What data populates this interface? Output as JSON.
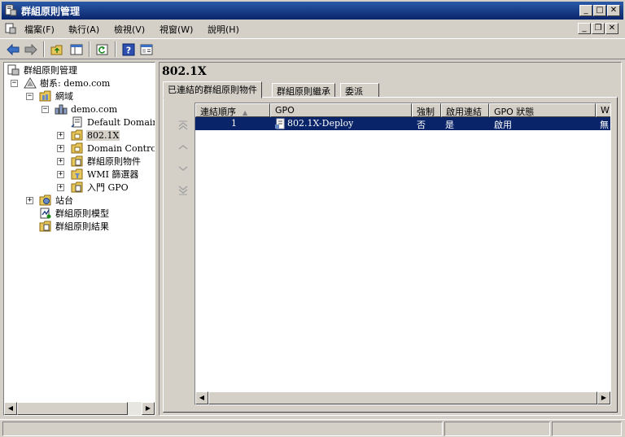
{
  "window": {
    "title": "群組原則管理",
    "minimize": "_",
    "maximize": "□",
    "close": "✕"
  },
  "menu": {
    "items": [
      {
        "label": "檔案(F)"
      },
      {
        "label": "執行(A)"
      },
      {
        "label": "檢視(V)"
      },
      {
        "label": "視窗(W)"
      },
      {
        "label": "說明(H)"
      }
    ]
  },
  "toolbar": {
    "buttons": [
      "back-icon",
      "forward-icon",
      "up-folder-icon",
      "show-hide-tree-icon",
      "refresh-icon",
      "help-icon",
      "properties-icon"
    ]
  },
  "tree": {
    "root": "群組原則管理",
    "forest": "樹系: demo.com",
    "domains": "網域",
    "domain": "demo.com",
    "items": [
      "Default Domain P",
      "802.1X",
      "Domain Controlle",
      "群組原則物件",
      "WMI 篩選器",
      "入門 GPO"
    ],
    "sites": "站台",
    "modeling": "群組原則模型",
    "results": "群組原則結果"
  },
  "right": {
    "title": "802.1X",
    "tabs": [
      "已連結的群組原則物件",
      "群組原則繼承",
      "委派"
    ],
    "columns": [
      "連結順序",
      "GPO",
      "強制",
      "啟用連結",
      "GPO 狀態",
      "W"
    ],
    "rows": [
      {
        "order": "1",
        "gpo": "802.1X-Deploy",
        "enforced": "否",
        "link_enabled": "是",
        "status": "啟用",
        "wmi": "無"
      }
    ]
  },
  "colors": {
    "title_bar": "#0a246a",
    "selection": "#0a246a",
    "face": "#d4d0c8"
  }
}
